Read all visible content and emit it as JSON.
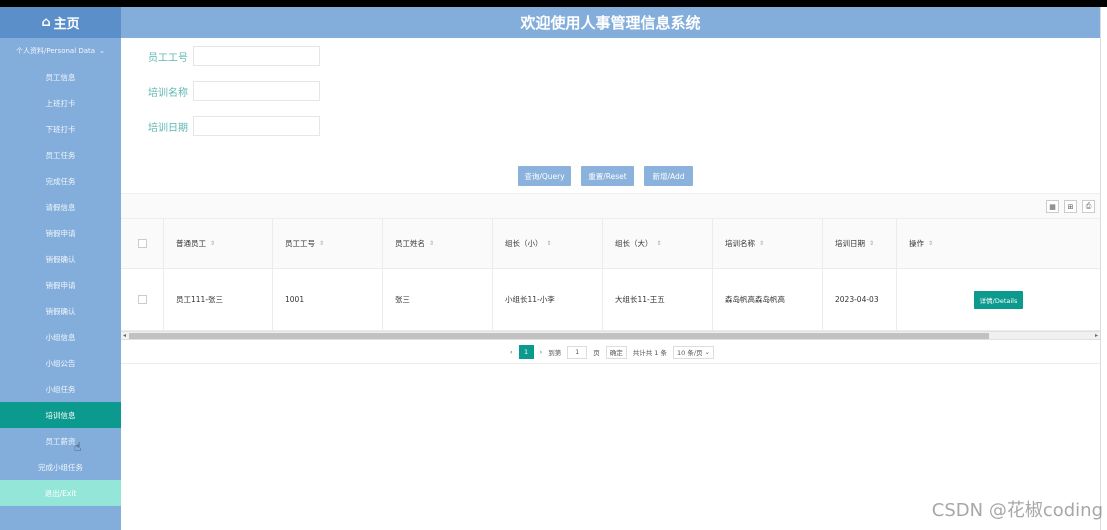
{
  "sidebar": {
    "home_icon": "⌂",
    "home_label": "主页",
    "group_label": "个人资料/Personal Data",
    "group_chevron": "⌄",
    "items": [
      {
        "label": "员工信息"
      },
      {
        "label": "上班打卡"
      },
      {
        "label": "下班打卡"
      },
      {
        "label": "员工任务"
      },
      {
        "label": "完成任务"
      },
      {
        "label": "请假信息"
      },
      {
        "label": "销假申请"
      },
      {
        "label": "销假确认"
      },
      {
        "label": "销假申请"
      },
      {
        "label": "销假确认"
      },
      {
        "label": "小组信息"
      },
      {
        "label": "小组公告"
      },
      {
        "label": "小组任务"
      },
      {
        "label": "培训信息",
        "active": true
      },
      {
        "label": "员工薪资"
      },
      {
        "label": "完成小组任务"
      }
    ],
    "exit_label": "退出/Exit"
  },
  "header": {
    "title": "欢迎使用人事管理信息系统"
  },
  "form": {
    "employee_no_label": "员工工号",
    "training_name_label": "培训名称",
    "training_date_label": "培训日期"
  },
  "buttons": {
    "query": "查询/Query",
    "reset": "重置/Reset",
    "add": "新增/Add"
  },
  "toolbar": {
    "icons": [
      "▦",
      "⊞",
      "⎙"
    ]
  },
  "table": {
    "columns": [
      "普通员工",
      "员工工号",
      "员工姓名",
      "组长（小）",
      "组长（大）",
      "培训名称",
      "培训日期",
      "操作"
    ],
    "sort_glyph": "⇕",
    "rows": [
      {
        "cells": [
          "员工111-张三",
          "1001",
          "张三",
          "小组长11-小李",
          "大组长11-王五",
          "森岛帆高森岛帆高",
          "2023-04-03"
        ],
        "action": "详情/Details"
      }
    ]
  },
  "pagination": {
    "prev": "‹",
    "current_page": "1",
    "next": "›",
    "goto_label": "到第",
    "goto_value": "1",
    "page_unit": "页",
    "confirm": "确定",
    "total": "共计共 1 条",
    "page_size": "10 条/页",
    "page_size_chevron": "⌄"
  },
  "watermark": "CSDN @花椒coding",
  "colors": {
    "sidebar": "#83aedb",
    "accent": "#0b9a8d",
    "button": "#8ab2dc",
    "label": "#5cb6b0"
  }
}
